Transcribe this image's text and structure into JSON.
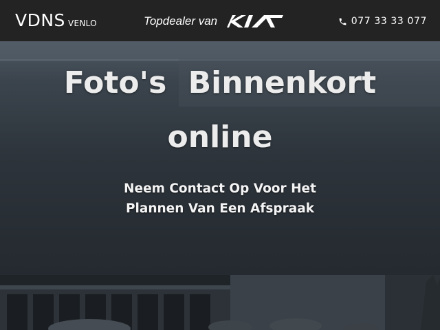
{
  "header": {
    "brand": "VDNS",
    "brand_location": "VENLO",
    "dealer_text": "Topdealer van",
    "dealer_logo": "KIA",
    "phone_icon": "phone-icon",
    "phone": "077 33 33 077"
  },
  "hero": {
    "headline_line1": "Foto's  Binnenkort",
    "headline_line2": "online",
    "subline1": "Neem Contact Op Voor Het",
    "subline2": "Plannen Van Een Afspraak"
  },
  "colors": {
    "header_bg": "#232323",
    "hero_text": "#ececec"
  }
}
